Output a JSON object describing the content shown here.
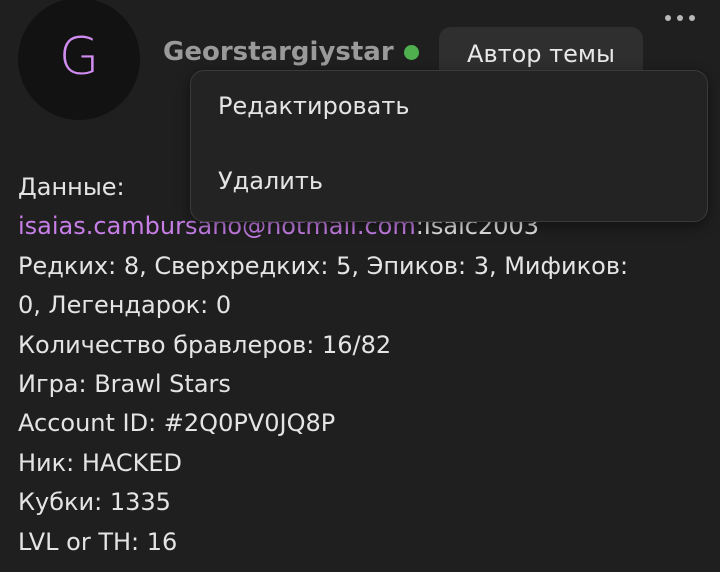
{
  "post": {
    "avatar_letter": "G",
    "username": "Georstargiystar",
    "author_badge": "Автор темы"
  },
  "menu": {
    "edit_label": "Редактировать",
    "delete_label": "Удалить"
  },
  "content": {
    "data_label": "Данные:",
    "email": "isaias.cambursano@hotmail.com",
    "password_suffix": ":Isaic2003",
    "rarity_line1": "Редких: 8, Сверхредких: 5, Эпиков: 3, Мификов:",
    "rarity_line2": "0, Легендарок: 0",
    "brawlers": "Количество бравлеров: 16/82",
    "game": "Игра: Brawl Stars",
    "account_id": "Account ID: #2Q0PV0JQ8P",
    "nick": "Ник: HACKED",
    "cups": "Кубки: 1335",
    "level": "LVL or TH: 16"
  },
  "colors": {
    "background": "#1f1f1f",
    "avatar_letter": "#d08cf0",
    "online_status": "#4fae4e",
    "link": "#c77ee8"
  },
  "icons": {
    "more": "more-horizontal-icon",
    "online": "online-status-dot"
  }
}
